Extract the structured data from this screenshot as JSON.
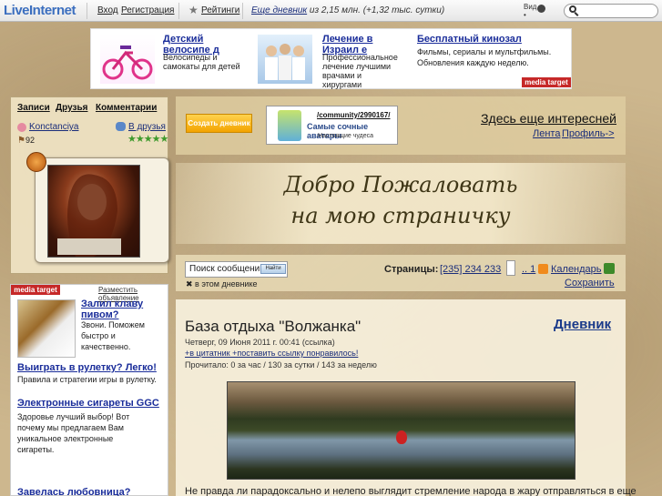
{
  "topbar": {
    "logo": "LiveInternet",
    "login": "Вход",
    "register": "Регистрация",
    "ratings": "Рейтинги",
    "stats_link": "Еще дневник",
    "stats_text": " из 2,15 млн. (+1,32 тыс. сутки)",
    "view_label_1": "Вид",
    "view_label_2": "•",
    "search_placeholder": ""
  },
  "ads_top": [
    {
      "title": "Детский велосипе д",
      "text": "Велосипеды и самокаты для детей",
      "icon": "bicycle-image"
    },
    {
      "title": "Лечение в Израил е",
      "text": "Профессиональное лечение лучшими врачами и хирургами",
      "icon": "doctors-image"
    },
    {
      "title": "Бесплатный кинозал",
      "text": "Фильмы, сериалы и мультфильмы. Обновления каждую неделю.",
      "icon": ""
    }
  ],
  "media_target": "media target",
  "left": {
    "nav": [
      "Записи",
      "Друзья",
      "Комментарии"
    ],
    "username": "Konctanciya",
    "to_friends": "В друзья",
    "rank": "92",
    "stars": "★★★★★"
  },
  "left_ads": {
    "place_ad": "Разместить объявление",
    "items": [
      {
        "title": "Залил клаву пивом?",
        "text": "Звони. Поможем быстро и качественно."
      },
      {
        "title": "Выиграть в рулетку? Легко!",
        "text": "Правила и стратегии игры в рулетку."
      },
      {
        "title": "Электронные сигареты GGC",
        "text": "Здоровье лучший выбор! Вот почему мы предлагаем Вам уникальное электронные сигареты."
      },
      {
        "title": "Завелась любовница?",
        "text": ""
      }
    ]
  },
  "main_top": {
    "create_diary": "Создать дневник",
    "community_link": "/community/2990167/",
    "community_title": "Самые сочные аватары",
    "community_sub": "Настоящие чудеса",
    "more_interesting": "Здесь еще интересней",
    "feed": "Лента",
    "profile": "Профиль->"
  },
  "banner": {
    "line1": "Добро Пожаловать",
    "line2": "на мою страничку"
  },
  "search_row": {
    "placeholder": "Поиск сообщений",
    "find_button": "Найти",
    "in_diary": "в этом дневнике",
    "pages_label": "Страницы:",
    "pages_value": "[235] 234 233 ",
    "pages_tail": ".. 1",
    "calendar": "Календарь",
    "save": "Сохранить"
  },
  "post": {
    "title": "База отдыха \"Волжанка\"",
    "diary_link": "Дневник",
    "date": "Четверг, 09 Июня 2011 г. 00:41 (ссылка)",
    "actions": "+в цитатник +поставить ссылку понравилось!",
    "stats": "Прочитало: 0 за час / 130 за сутки / 143 за неделю",
    "text": "Не правда ли парадоксально и нелепо выглядит стремление народа в жару отправляться в еще"
  }
}
